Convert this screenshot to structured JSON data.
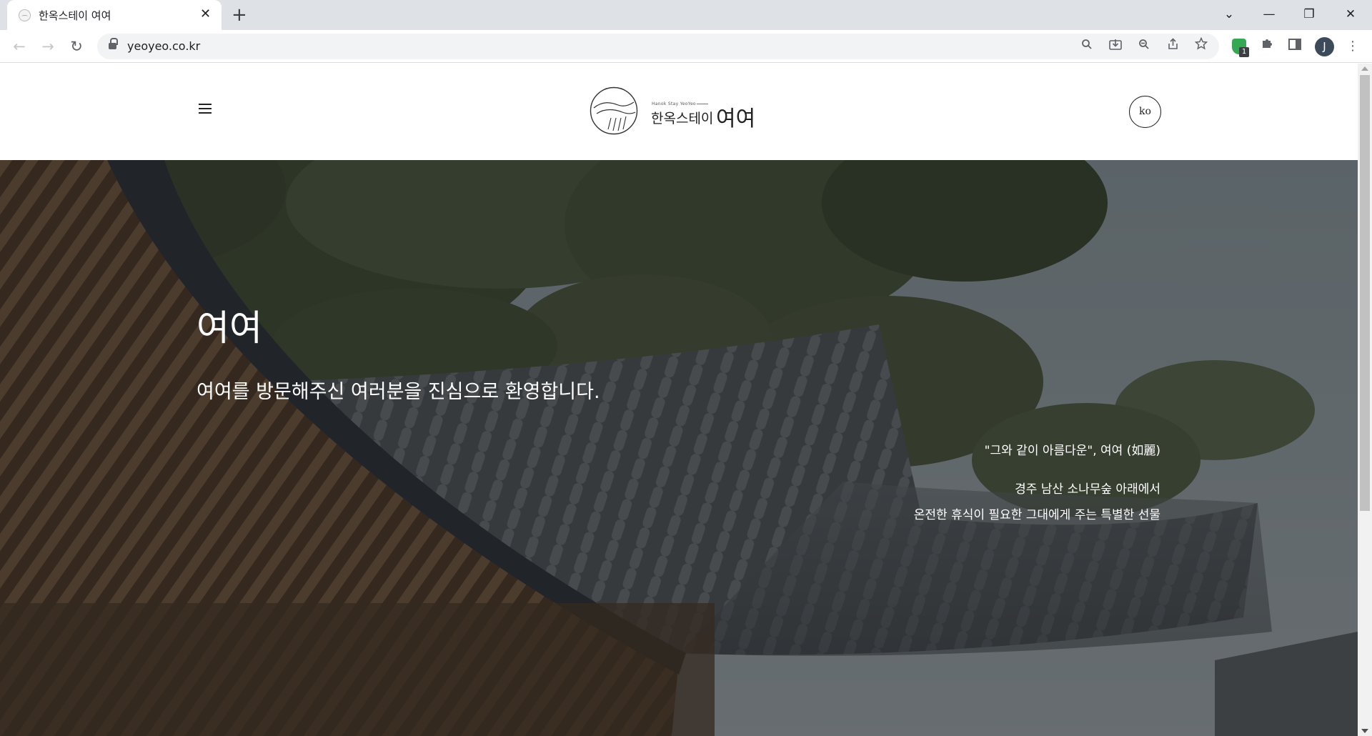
{
  "browser": {
    "tab_title": "한옥스테이 여여",
    "tab_close": "✕",
    "new_tab": "+",
    "url": "yeoyeo.co.kr",
    "extension_badge": "1",
    "profile_initial": "J",
    "window_controls": {
      "tab_search": "⌄",
      "minimize": "—",
      "restore": "❐",
      "close": "✕"
    },
    "icons": [
      "back-icon",
      "forward-icon",
      "reload-icon",
      "lock-icon",
      "search-icon",
      "install-icon",
      "zoom-out-icon",
      "share-icon",
      "bookmark-star-icon",
      "extension-shield-icon",
      "puzzle-icon",
      "side-panel-icon",
      "more-icon"
    ]
  },
  "header": {
    "menu_icon": "hamburger-icon",
    "logo": {
      "subtitle": "Hanok Stay YeoYeo",
      "name_small": "한옥스테이",
      "name_big": "여여"
    },
    "language": "ko"
  },
  "hero": {
    "title": "여여",
    "subtitle": "여여를 방문해주신 여러분을 진심으로 환영합니다.",
    "quote": "\"그와 같이 아름다운\", 여여 (如麗)",
    "line1": "경주 남산 소나무숲 아래에서",
    "line2": "온전한 휴식이 필요한 그대에게 주는 특별한 선물"
  },
  "colors": {
    "tabbar_bg": "#dee1e6",
    "omnibox_bg": "#f1f3f4",
    "hero_text": "#ffffff",
    "header_text": "#222222"
  }
}
